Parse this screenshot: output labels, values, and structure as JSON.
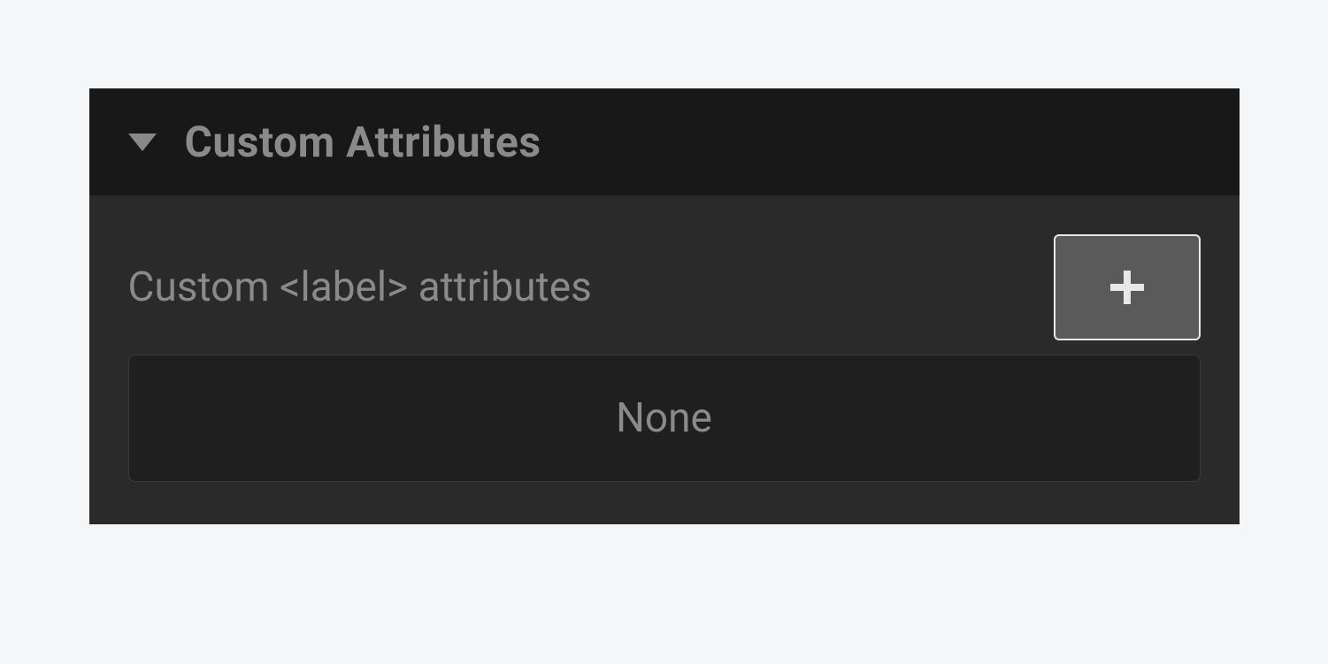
{
  "panel": {
    "title": "Custom Attributes",
    "row_label": "Custom <label> attributes",
    "value": "None"
  }
}
